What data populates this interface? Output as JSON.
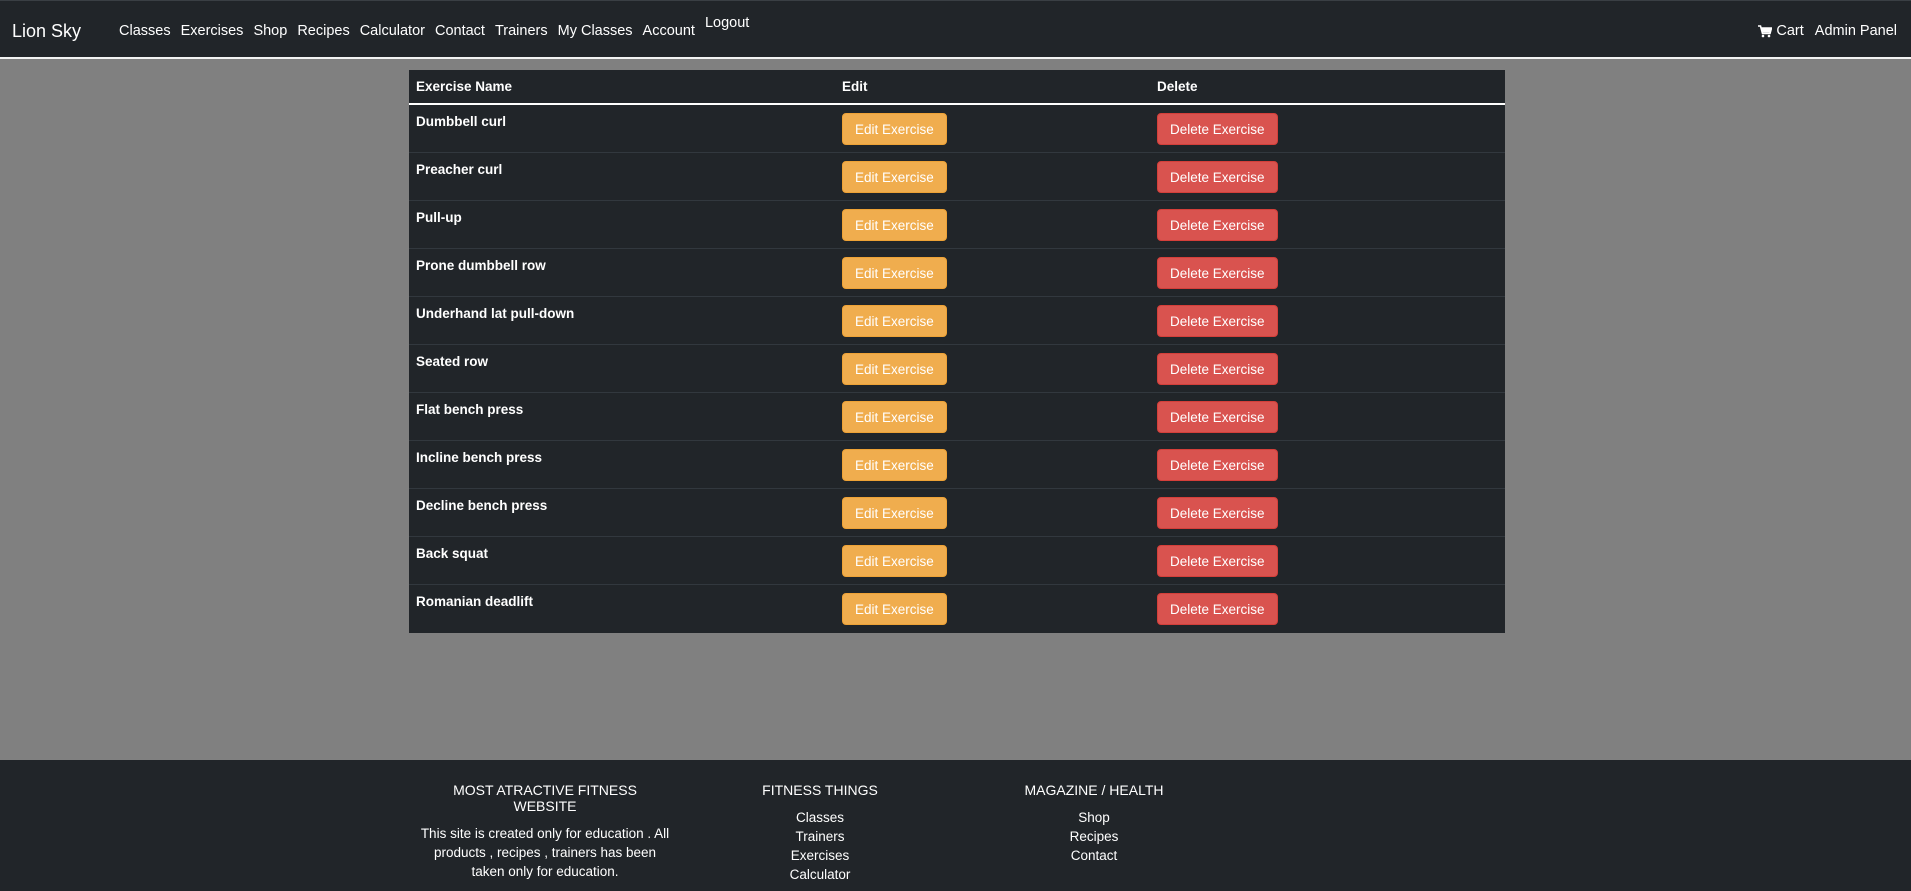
{
  "nav": {
    "brand": "Lion Sky",
    "links": [
      "Classes",
      "Exercises",
      "Shop",
      "Recipes",
      "Calculator",
      "Contact",
      "Trainers",
      "My Classes",
      "Account"
    ],
    "logout": "Logout",
    "cart": "Cart",
    "admin": "Admin Panel"
  },
  "table": {
    "headers": {
      "name": "Exercise Name",
      "edit": "Edit",
      "delete": "Delete"
    },
    "edit_label": "Edit Exercise",
    "delete_label": "Delete Exercise",
    "rows": [
      "Dumbbell curl",
      "Preacher curl",
      "Pull-up",
      "Prone dumbbell row",
      "Underhand lat pull-down",
      "Seated row",
      "Flat bench press",
      "Incline bench press",
      "Decline bench press",
      "Back squat",
      "Romanian deadlift"
    ]
  },
  "footer": {
    "col1": {
      "title": "MOST ATRACTIVE FITNESS WEBSITE",
      "text": "This site is created only for education . All products , recipes , trainers has been taken only for education."
    },
    "col2": {
      "title": "FITNESS THINGS",
      "links": [
        "Classes",
        "Trainers",
        "Exercises",
        "Calculator"
      ]
    },
    "col3": {
      "title": "MAGAZINE / HEALTH",
      "links": [
        "Shop",
        "Recipes",
        "Contact"
      ]
    }
  }
}
